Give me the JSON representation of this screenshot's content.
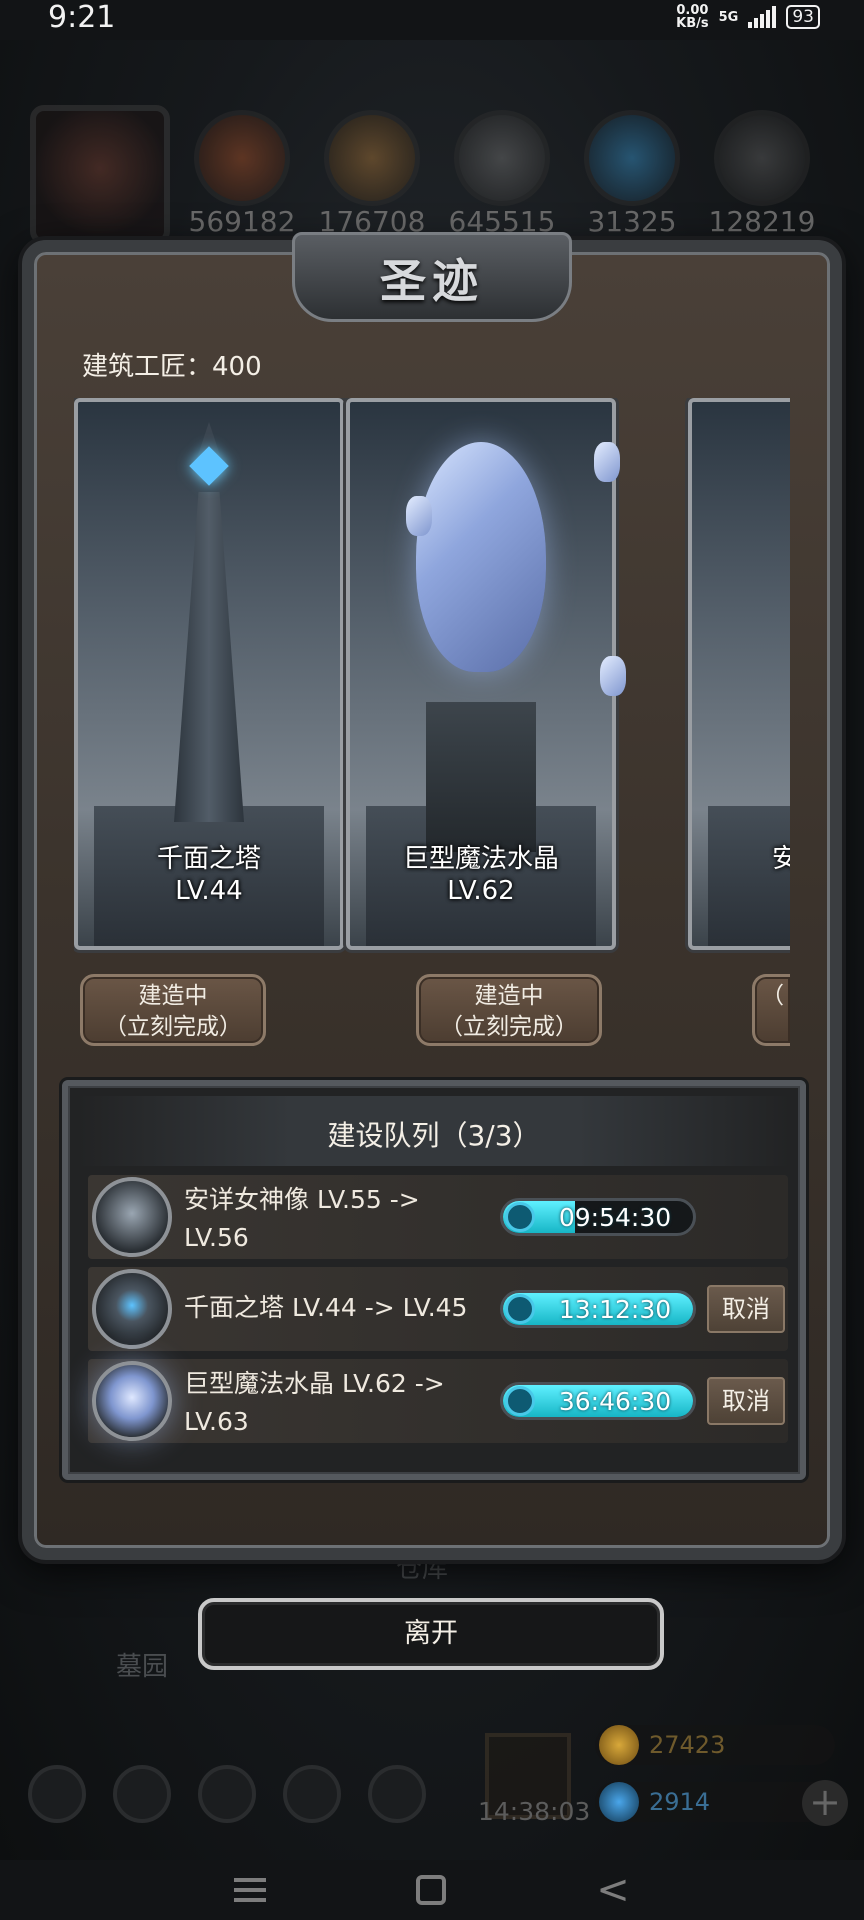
{
  "status_bar": {
    "time": "9:21",
    "net_speed": "0.00",
    "net_unit": "KB/s",
    "signal": "5G",
    "battery": "93"
  },
  "background": {
    "resources": [
      "569182",
      "176708",
      "645515",
      "31325",
      "128219"
    ],
    "labels": {
      "warehouse": "仓库",
      "cemetery": "墓园"
    },
    "timer": "14:38:03",
    "gold": "27423",
    "gems": "2914"
  },
  "modal": {
    "title": "圣迹",
    "builder_label": "建筑工匠：400",
    "cards": [
      {
        "name": "千面之塔",
        "level": "LV.44"
      },
      {
        "name": "巨型魔法水晶",
        "level": "LV.62"
      },
      {
        "name": "安",
        "level": ""
      }
    ],
    "build_buttons": [
      {
        "line1": "建造中",
        "line2": "（立刻完成）"
      },
      {
        "line1": "建造中",
        "line2": "（立刻完成）"
      },
      {
        "line1": "",
        "line2": "（"
      }
    ],
    "queue": {
      "title": "建设队列（3/3）",
      "items": [
        {
          "label": "安详女神像 LV.55 -> LV.56",
          "timer": "09:54:30",
          "progress": 0.38,
          "cancel": ""
        },
        {
          "label": "千面之塔 LV.44 -> LV.45",
          "timer": "13:12:30",
          "progress": 1.0,
          "cancel": "取消"
        },
        {
          "label": "巨型魔法水晶 LV.62 -> LV.63",
          "timer": "36:46:30",
          "progress": 1.0,
          "cancel": "取消"
        }
      ]
    },
    "leave_label": "离开"
  },
  "colors": {
    "timer_fill": "#17b6c6",
    "panel_brown": "#3b332c",
    "frame_steel": "#6d7175"
  }
}
